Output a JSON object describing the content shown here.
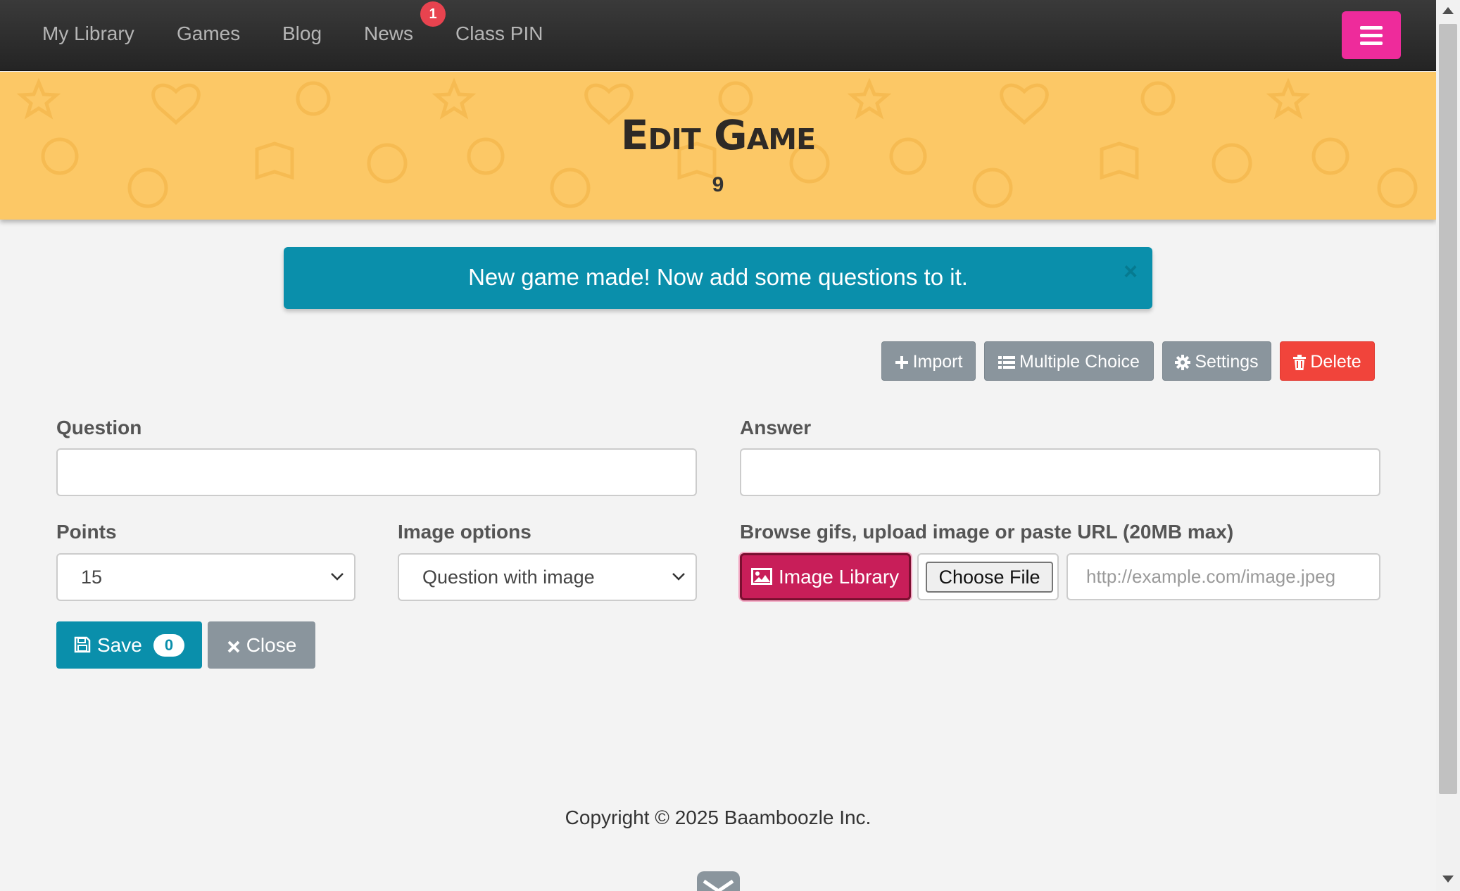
{
  "nav": {
    "items": [
      {
        "label": "My Library"
      },
      {
        "label": "Games"
      },
      {
        "label": "Blog"
      },
      {
        "label": "News"
      },
      {
        "label": "Class PIN"
      }
    ],
    "news_badge": "1",
    "menu_icon": "hamburger-icon"
  },
  "header": {
    "title": "Edit Game",
    "subtitle": "9"
  },
  "alert": {
    "message": "New game made! Now add some questions to it.",
    "close_symbol": "×"
  },
  "toolbar": {
    "import_label": "Import",
    "multiple_choice_label": "Multiple Choice",
    "settings_label": "Settings",
    "delete_label": "Delete"
  },
  "form": {
    "question_label": "Question",
    "question_value": "",
    "answer_label": "Answer",
    "answer_value": "",
    "points_label": "Points",
    "points_value": "15",
    "image_options_label": "Image options",
    "image_options_value": "Question with image",
    "browse_label": "Browse gifs, upload image or paste URL (20MB max)",
    "image_library_label": "Image Library",
    "choose_file_label": "Choose File",
    "url_placeholder": "http://example.com/image.jpeg",
    "save_label": "Save",
    "save_count": "0",
    "close_label": "Close"
  },
  "footer": {
    "copyright": "Copyright © 2025 Baamboozle Inc."
  },
  "colors": {
    "navbar": "#2e2e2e",
    "menu_button": "#ee2b9b",
    "header_band": "#fcc866",
    "alert": "#0a8fab",
    "primary": "#0a8fab",
    "secondary": "#8a959d",
    "danger": "#f1443b",
    "image_library": "#c81e59"
  }
}
